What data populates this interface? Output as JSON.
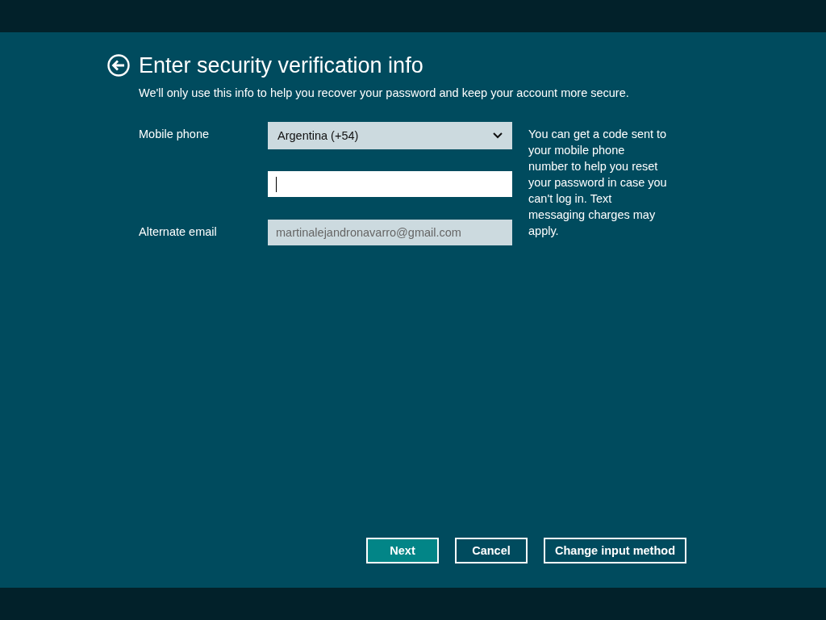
{
  "title": "Enter security verification info",
  "subtitle": "We'll only use this info to help you recover your password and keep your account more secure.",
  "fields": [
    {
      "kind": "dropdown",
      "label": "Mobile phone",
      "value": "Argentina (+54)"
    },
    {
      "kind": "text",
      "focused": true
    },
    {
      "kind": "text",
      "label": "Alternate email",
      "value": "martinalejandronavarro@gmail.com",
      "disabled": true
    }
  ],
  "help": "You can get a code sent to your mobile phone number to help you reset your password in case you can't log in. Text messaging charges may apply.",
  "buttons": [
    {
      "label": "Next",
      "kind": "primary"
    },
    {
      "label": "Cancel",
      "kind": "secondary"
    },
    {
      "label": "Change input method",
      "kind": "secondary"
    }
  ]
}
